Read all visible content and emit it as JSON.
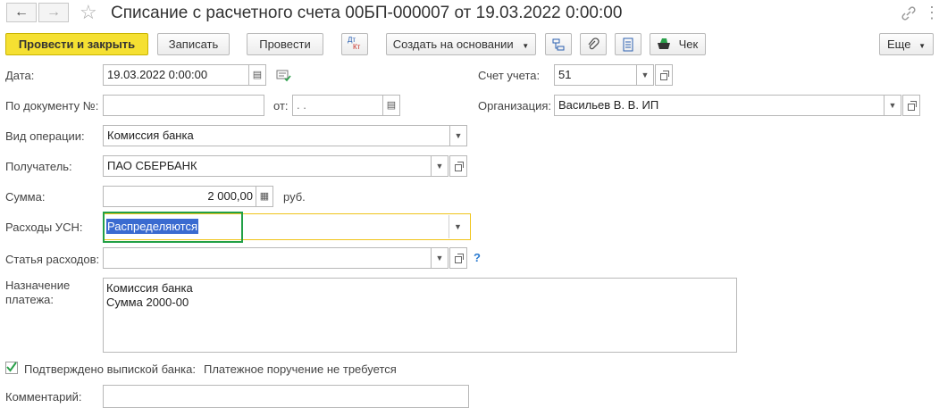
{
  "window": {
    "title": "Списание с расчетного счета 00БП-000007 от 19.03.2022 0:00:00"
  },
  "toolbar": {
    "post_close": "Провести и закрыть",
    "save": "Записать",
    "post": "Провести",
    "dtkt_top": "Дт",
    "dtkt_bottom": "Кт",
    "create_based": "Создать на основании",
    "check": "Чек",
    "more": "Еще"
  },
  "form": {
    "date_label": "Дата:",
    "date_value": "19.03.2022  0:00:00",
    "account_label": "Счет учета:",
    "account_value": "51",
    "docnum_label": "По документу №:",
    "docnum_value": "",
    "from_label": "от:",
    "from_value": " .  .",
    "org_label": "Организация:",
    "org_value": "Васильев В. В. ИП",
    "optype_label": "Вид операции:",
    "optype_value": "Комиссия банка",
    "recipient_label": "Получатель:",
    "recipient_value": "ПАО СБЕРБАНК",
    "sum_label": "Сумма:",
    "sum_value": "2 000,00",
    "currency": "руб.",
    "usn_label": "Расходы УСН:",
    "usn_value": "Распределяются",
    "expense_label": "Статья расходов:",
    "expense_value": "",
    "help_mark": "?",
    "purpose_label_1": "Назначение",
    "purpose_label_2": "платежа:",
    "purpose_line_1": "Комиссия банка",
    "purpose_line_2": "Сумма 2000-00",
    "confirmed_label": "Подтверждено выпиской банка:",
    "confirmed_checked": true,
    "payment_order_note": "Платежное поручение не требуется",
    "comment_label": "Комментарий:",
    "comment_value": ""
  },
  "colors": {
    "primary_button": "#f5e032",
    "highlight_green": "#22a046",
    "focus_yellow": "#f0c419",
    "selection": "#3a6bd0",
    "help": "#2a7ad0"
  }
}
